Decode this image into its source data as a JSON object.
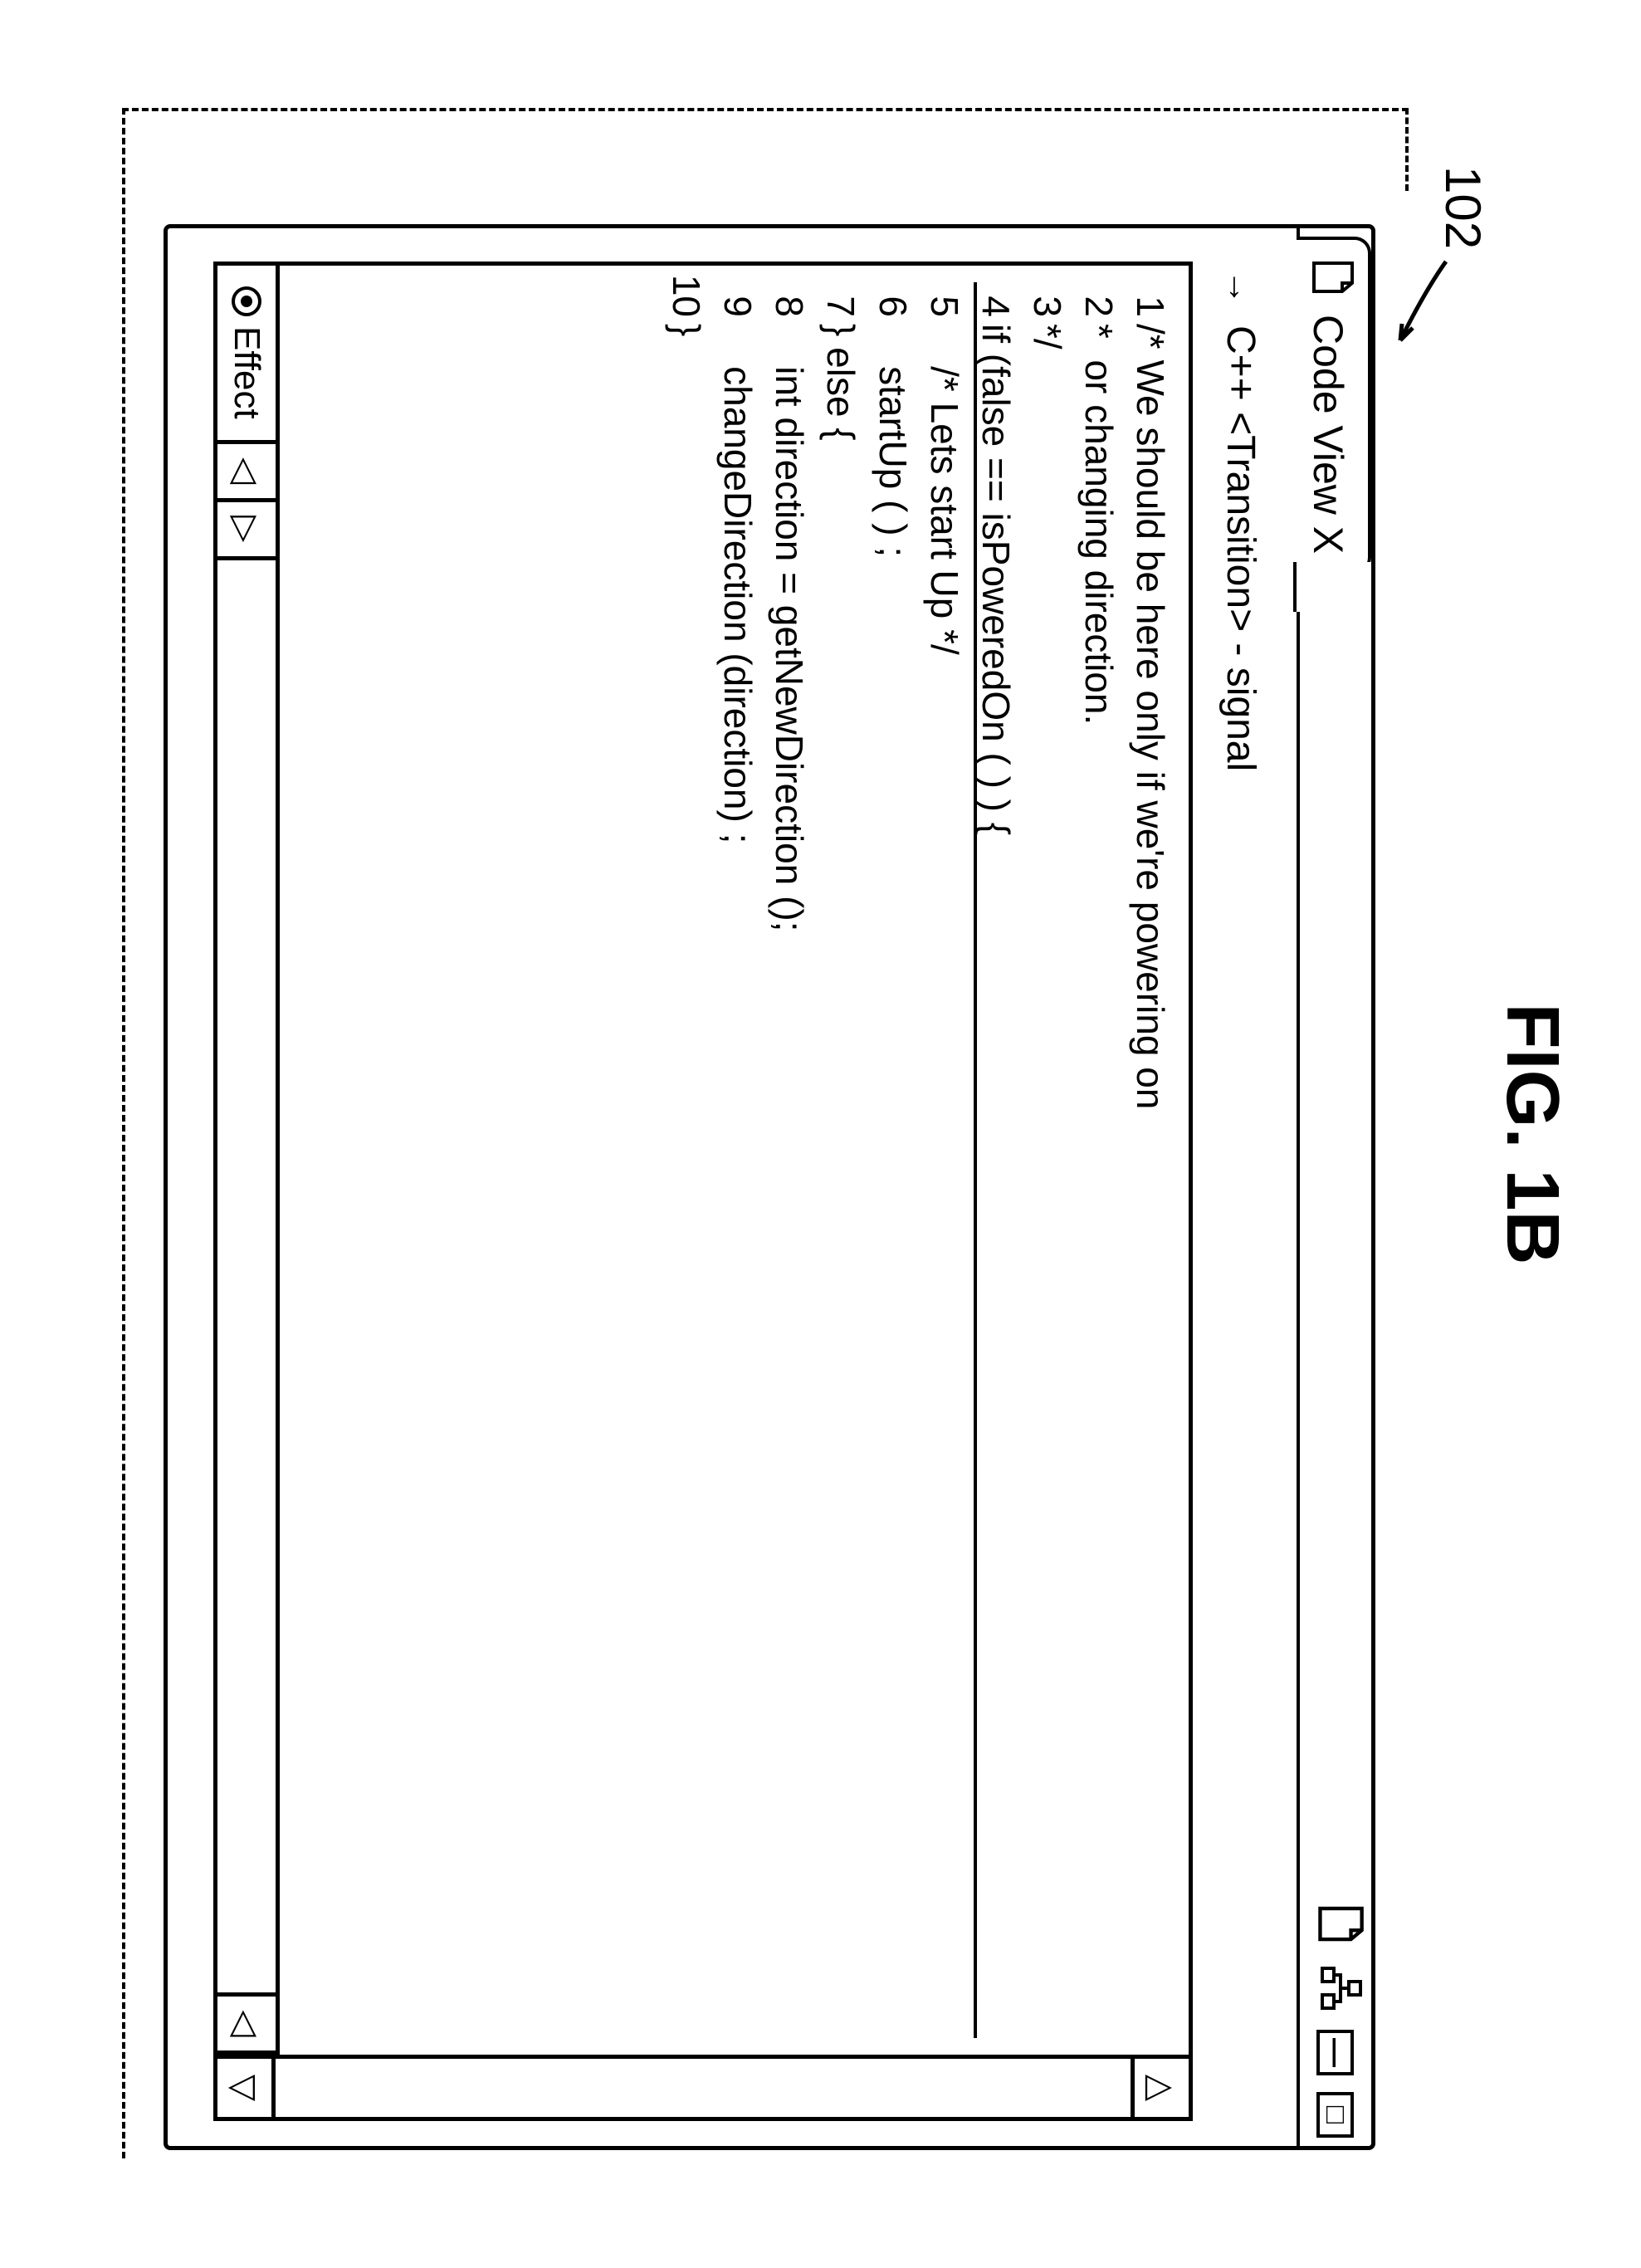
{
  "figure": {
    "label": "FIG. 1B",
    "ref_number": "102"
  },
  "window": {
    "title": "Code View X",
    "breadcrumb": "C++ <Transition> - signal"
  },
  "code": {
    "lines": [
      {
        "num": "1",
        "text": "/* We should be here only if we're powering on"
      },
      {
        "num": "2",
        "text": "*  or changing direction."
      },
      {
        "num": "3",
        "text": "*/"
      },
      {
        "num": "4",
        "text": "if (false == isPoweredOn ( ) ) {"
      },
      {
        "num": "5",
        "text": "    /* Lets start Up */"
      },
      {
        "num": "6",
        "text": "    startUp ( ) ;"
      },
      {
        "num": "7",
        "text": "} else {"
      },
      {
        "num": "8",
        "text": "    int direction = getNewDirection ();"
      },
      {
        "num": "9",
        "text": "    changeDirection (direction) ;"
      },
      {
        "num": "10",
        "text": "}"
      }
    ]
  },
  "effect_tab": {
    "label": "Effect"
  },
  "icons": {
    "file": "📄",
    "file2": "📄",
    "network": "🖧"
  }
}
